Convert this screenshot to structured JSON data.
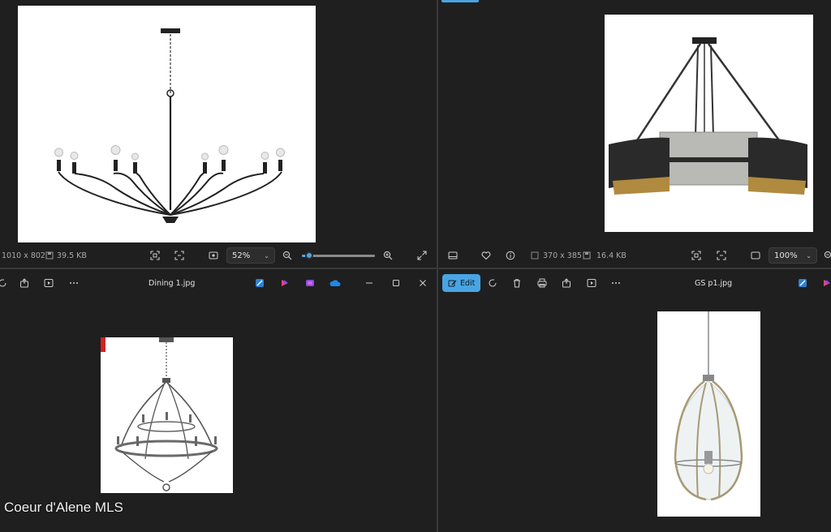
{
  "top_left": {
    "status": {
      "dimensions": "1010 x 802",
      "size": "39.5 KB",
      "zoom": "52%",
      "zoom_fraction": 0.1
    }
  },
  "top_right": {
    "status": {
      "dimensions": "370 x 385",
      "size": "16.4 KB",
      "zoom": "100%"
    }
  },
  "bottom_left": {
    "toolbar": {
      "filename": "Dining 1.jpg"
    }
  },
  "bottom_right": {
    "toolbar": {
      "edit_label": "Edit",
      "filename": "GS p1.jpg"
    }
  },
  "watermark": "Coeur d'Alene MLS",
  "colors": {
    "accent": "#4aa4e3",
    "background": "#1f1f1f"
  }
}
